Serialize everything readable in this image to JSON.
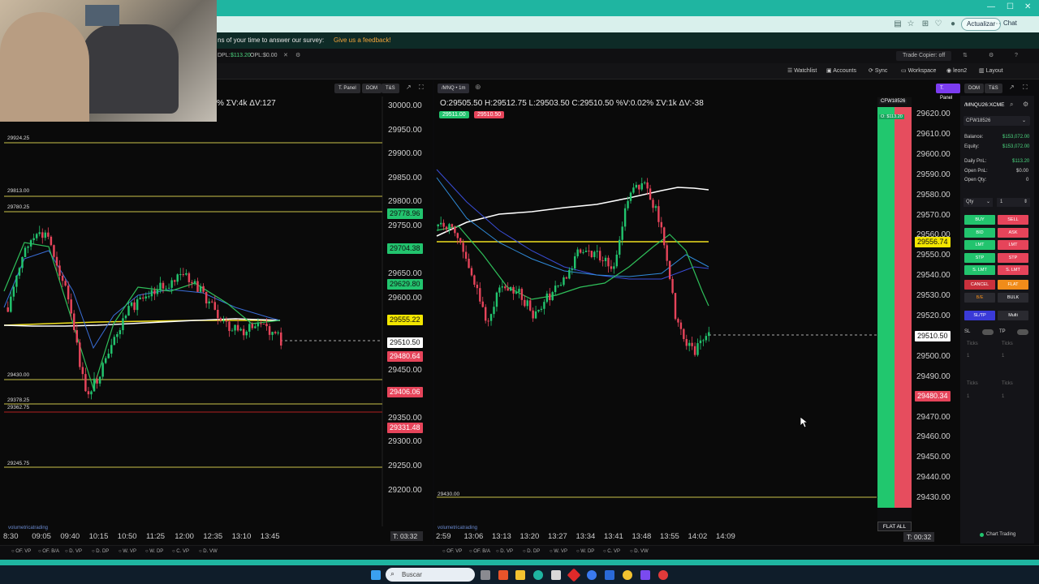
{
  "browser": {
    "survey_text": "ns of your time to answer our survey:",
    "survey_link": "Give us a feedback!",
    "actualizar": "Actualizar",
    "chat": "Chat"
  },
  "toolbar1": {
    "dpl": "DPL:",
    "dpl_val": "$113.20",
    "opl": "OPL:",
    "opl_val": "$0.00",
    "trade_copier": "Trade Copier: off"
  },
  "toolbar2": {
    "watchlist": "Watchlist",
    "accounts": "Accounts",
    "sync": "Sync",
    "workspace": "Workspace",
    "user": "leon2",
    "layout": "Layout"
  },
  "left_chart": {
    "header_tabs": [
      "T. Panel",
      "DOM",
      "T&S"
    ],
    "stats": "% ΣV:4k ΔV:127",
    "price_axis": [
      "30000.00",
      "29950.00",
      "29900.00",
      "29850.00",
      "29800.00",
      "29750.00",
      "29700.00",
      "29650.00",
      "29600.00",
      "29550.00",
      "29500.00",
      "29450.00",
      "29400.00",
      "29350.00",
      "29300.00",
      "29250.00",
      "29200.00"
    ],
    "tags": [
      {
        "text": "29778.96",
        "kind": "green"
      },
      {
        "text": "29704.38",
        "kind": "green"
      },
      {
        "text": "29629.80",
        "kind": "green"
      },
      {
        "text": "29555.22",
        "kind": "yellow"
      },
      {
        "text": "29510.50",
        "kind": "white"
      },
      {
        "text": "29480.64",
        "kind": "red"
      },
      {
        "text": "29406.06",
        "kind": "red"
      },
      {
        "text": "29331.48",
        "kind": "red"
      }
    ],
    "levels": [
      "29924.25",
      "29813.00",
      "29780.25",
      "29430.00",
      "29378.25",
      "29362.75",
      "29245.75"
    ],
    "time_axis": [
      "8:30",
      "09:05",
      "09:40",
      "10:15",
      "10:50",
      "11:25",
      "12:00",
      "12:35",
      "13:10",
      "13:45"
    ],
    "timer": "T: 03:32",
    "watermark": "volumetricatrading"
  },
  "right_chart": {
    "symbol_tab": "/MNQ",
    "interval": "1m",
    "ohlc": "O:29505.50  H:29512.75  L:29503.50  C:29510.50  %V:0.02%  ΣV:1k  ΔV:-38",
    "bid_badge": "29511.00",
    "ask_badge": "29510.50",
    "header_tabs": [
      "T. Panel",
      "DOM",
      "T&S"
    ],
    "price_axis": [
      "29620.00",
      "29610.00",
      "29600.00",
      "29590.00",
      "29580.00",
      "29570.00",
      "29560.00",
      "29550.00",
      "29540.00",
      "29530.00",
      "29520.00",
      "29510.00",
      "29500.00",
      "29490.00",
      "29480.00",
      "29470.00",
      "29460.00",
      "29450.00",
      "29440.00",
      "29430.00"
    ],
    "tag_yellow": "29556.74",
    "tag_white": "29510.50",
    "tag_red": "29480.34",
    "level_bottom": "29430.00",
    "time_axis": [
      "2:59",
      "13:06",
      "13:13",
      "13:20",
      "13:27",
      "13:34",
      "13:41",
      "13:48",
      "13:55",
      "14:02",
      "14:09"
    ],
    "timer": "T: 00:32",
    "account_top": "CFW18526",
    "account_pnl": "O: $113.20",
    "flat_all": "FLAT ALL",
    "watermark": "volumetricatrading"
  },
  "vp_buttons": [
    "OF. VP",
    "OF. B/A",
    "D. VP",
    "D. DP",
    "W. VP",
    "W. DP",
    "C. VP",
    "D. VW"
  ],
  "side_panel": {
    "symbol": "/MNQU26:XCME",
    "account": "CFW18526",
    "balance_label": "Balance:",
    "balance": "$153,072.00",
    "equity_label": "Equity:",
    "equity": "$153,072.00",
    "daily_pnl_label": "Daily PnL:",
    "daily_pnl": "$113.20",
    "open_pnl_label": "Open PnL:",
    "open_pnl": "$0.00",
    "open_qty_label": "Open Qty:",
    "open_qty": "0",
    "qty_label": "Qty",
    "qty_value": "1",
    "buttons": [
      [
        "BUY",
        "SELL"
      ],
      [
        "BID",
        "ASK"
      ],
      [
        "LMT",
        "LMT"
      ],
      [
        "STP",
        "STP"
      ],
      [
        "S. LMT",
        "S. LMT"
      ]
    ],
    "cancel": "CANCEL",
    "flat": "FLAT",
    "be": "B/E",
    "bulk": "BULK",
    "sltp": "SL/TP",
    "multi": "Multi",
    "sl": "SL",
    "tp": "TP",
    "ticks": "Ticks",
    "one": "1",
    "chart_trading": "Chart Trading"
  },
  "taskbar": {
    "search": "Buscar"
  },
  "colors": {
    "accent": "#7b3cf0",
    "green": "#22c46e",
    "red": "#e6445a",
    "yellow": "#f2e600",
    "browser_teal": "#1fb5a1"
  }
}
